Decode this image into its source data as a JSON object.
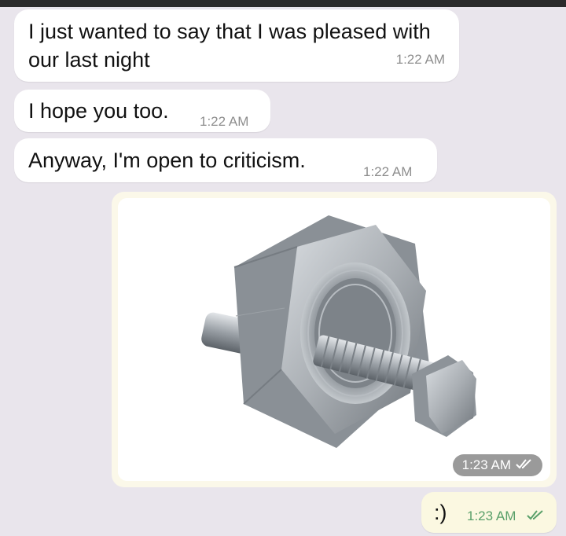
{
  "messages": [
    {
      "text": "I just wanted to say that I was pleased with our last night",
      "time": "1:22 AM"
    },
    {
      "text": "I hope you too.",
      "time": "1:22 AM"
    },
    {
      "text": "Anyway, I'm open to criticism.",
      "time": "1:22 AM"
    }
  ],
  "photo_message": {
    "image": "nut-and-bolt-photo",
    "time": "1:23 AM",
    "status_icon": "double-check-icon"
  },
  "reply": {
    "text": ":)",
    "time": "1:23 AM",
    "status_icon": "double-check-icon"
  },
  "colors": {
    "background": "#e9e5ec",
    "incoming_bubble": "#ffffff",
    "outgoing_bubble": "#fbf8e1",
    "timestamp": "#8e8e8e",
    "outgoing_timestamp": "#5aa06a"
  }
}
